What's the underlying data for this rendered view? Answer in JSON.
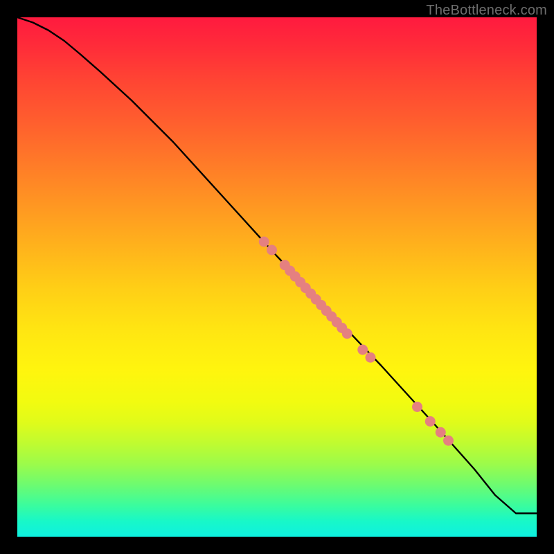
{
  "watermark": "TheBottleneck.com",
  "chart_data": {
    "type": "line",
    "title": "",
    "xlabel": "",
    "ylabel": "",
    "xlim": [
      0,
      100
    ],
    "ylim": [
      0,
      100
    ],
    "grid": false,
    "legend": false,
    "series": [
      {
        "name": "curve",
        "x": [
          0,
          3,
          6,
          9,
          12,
          16,
          22,
          30,
          40,
          50,
          60,
          70,
          80,
          88,
          92,
          96,
          100
        ],
        "y": [
          100,
          99,
          97.5,
          95.5,
          93,
          89.5,
          84,
          76,
          65,
          54,
          43.5,
          33,
          22,
          13,
          8,
          4.5,
          4.5
        ]
      }
    ],
    "scatter": {
      "name": "points",
      "color": "#e67b7b",
      "xy": [
        [
          47.5,
          56.8
        ],
        [
          49,
          55.2
        ],
        [
          51.5,
          52.3
        ],
        [
          52.5,
          51.2
        ],
        [
          53.5,
          50.1
        ],
        [
          54.5,
          49.0
        ],
        [
          55.5,
          47.9
        ],
        [
          56.5,
          46.8
        ],
        [
          57.5,
          45.7
        ],
        [
          58.5,
          44.6
        ],
        [
          59.5,
          43.5
        ],
        [
          60.5,
          42.4
        ],
        [
          61.5,
          41.3
        ],
        [
          62.5,
          40.2
        ],
        [
          63.5,
          39.1
        ],
        [
          66.5,
          36.0
        ],
        [
          68,
          34.5
        ],
        [
          77,
          25.0
        ],
        [
          79.5,
          22.2
        ],
        [
          81.5,
          20.1
        ],
        [
          83,
          18.5
        ]
      ]
    }
  },
  "colors": {
    "curve": "#000000",
    "point_fill": "#e58080",
    "point_stroke": "#c86b6b"
  }
}
